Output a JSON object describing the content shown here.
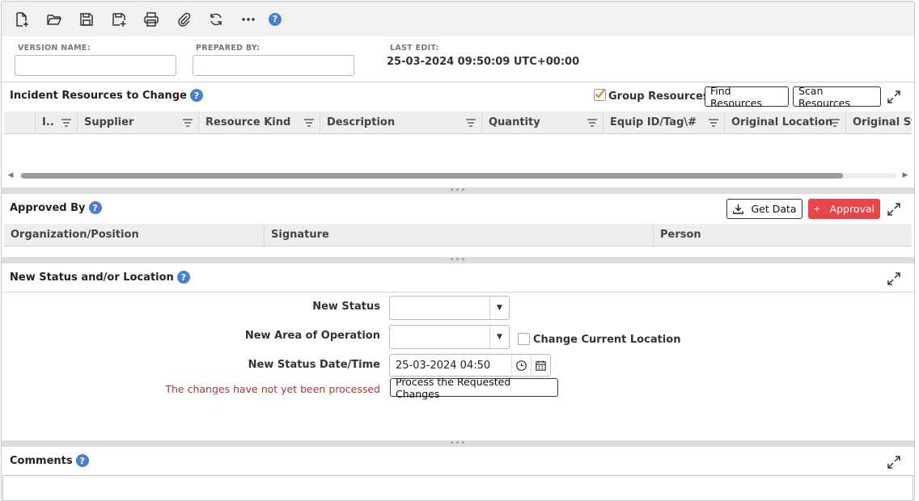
{
  "toolbar": {
    "items": [
      {
        "name": "new-document",
        "icon": "file-plus-icon"
      },
      {
        "name": "open",
        "icon": "folder-open-icon"
      },
      {
        "name": "save",
        "icon": "save-icon"
      },
      {
        "name": "save-as",
        "icon": "save-plus-icon"
      },
      {
        "name": "print",
        "icon": "printer-icon"
      },
      {
        "name": "attach",
        "icon": "paperclip-icon"
      },
      {
        "name": "refresh",
        "icon": "refresh-icon"
      },
      {
        "name": "more",
        "icon": "more-icon"
      }
    ],
    "help": "?"
  },
  "meta": {
    "version_name_label": "VERSION NAME:",
    "version_name_value": "",
    "prepared_by_label": "PREPARED BY:",
    "prepared_by_value": "",
    "last_edit_label": "LAST EDIT:",
    "last_edit_value": "25-03-2024 09:50:09 UTC+00:00"
  },
  "resources": {
    "title": "Incident Resources to Change",
    "help": "?",
    "group_resources_label": "Group Resources",
    "group_resources_checked": true,
    "find_button": "Find Resources",
    "scan_button": "Scan Resources",
    "columns": [
      "I..",
      "Supplier",
      "Resource Kind",
      "Description",
      "Quantity",
      "Equip ID/Tag\\#",
      "Original Location",
      "Original Sta"
    ],
    "rows": []
  },
  "approved": {
    "title": "Approved By",
    "help": "?",
    "get_data_button": "Get Data",
    "approval_button": "Approval",
    "columns": [
      "Organization/Position",
      "Signature",
      "Person"
    ],
    "rows": []
  },
  "status": {
    "title": "New Status and/or Location",
    "help": "?",
    "new_status_label": "New Status",
    "new_status_value": "",
    "area_label": "New Area of Operation",
    "area_value": "",
    "change_location_label": "Change Current Location",
    "change_location_checked": false,
    "date_label": "New Status Date/Time",
    "date_value": "25-03-2024 04:50",
    "message": "The changes have not yet been processed",
    "process_button": "Process the Requested Changes"
  },
  "comments": {
    "title": "Comments",
    "help": "?",
    "value": ""
  },
  "colors": {
    "accent_red": "#e8454a",
    "message_red": "#a33a2a",
    "help_blue": "#4a7fd0",
    "check_orange": "#e07a2a"
  }
}
